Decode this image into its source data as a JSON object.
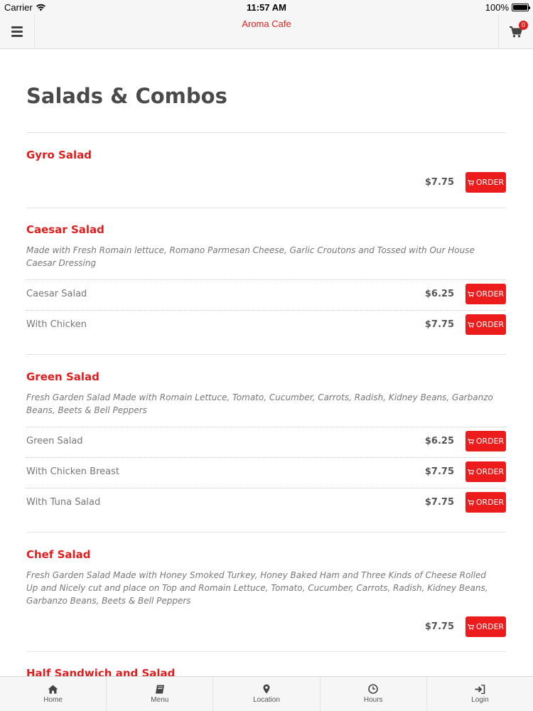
{
  "status_bar": {
    "carrier": "Carrier",
    "time": "11:57 AM",
    "battery": "100%"
  },
  "header": {
    "title": "Aroma Cafe",
    "cart_count": "0"
  },
  "page_title": "Salads & Combos",
  "order_label": "ORDER",
  "items": [
    {
      "title": "Gyro Salad",
      "description": "",
      "options": [
        {
          "name": "",
          "price": "$7.75"
        }
      ]
    },
    {
      "title": "Caesar Salad",
      "description": "Made with Fresh Romain lettuce, Romano Parmesan Cheese, Garlic Croutons and Tossed with Our House Caesar Dressing",
      "options": [
        {
          "name": "Caesar Salad",
          "price": "$6.25"
        },
        {
          "name": "With Chicken",
          "price": "$7.75"
        }
      ]
    },
    {
      "title": "Green Salad",
      "description": "Fresh Garden Salad Made with Romain Lettuce, Tomato, Cucumber, Carrots, Radish, Kidney Beans, Garbanzo Beans, Beets & Bell Peppers",
      "options": [
        {
          "name": "Green Salad",
          "price": "$6.25"
        },
        {
          "name": "With Chicken Breast",
          "price": "$7.75"
        },
        {
          "name": "With Tuna Salad",
          "price": "$7.75"
        }
      ]
    },
    {
      "title": "Chef Salad",
      "description": "Fresh Garden Salad Made with Honey Smoked Turkey, Honey Baked Ham and Three Kinds of Cheese Rolled Up and Nicely cut and place on Top and Romain Lettuce, Tomato, Cucumber, Carrots, Radish, Kidney Beans, Garbanzo Beans, Beets & Bell Peppers",
      "options": [
        {
          "name": "",
          "price": "$7.75"
        }
      ]
    },
    {
      "title": "Half Sandwich and Salad",
      "description": "",
      "options": []
    }
  ],
  "tabs": [
    {
      "label": "Home",
      "icon": "home-icon"
    },
    {
      "label": "Menu",
      "icon": "book-icon"
    },
    {
      "label": "Location",
      "icon": "map-marker-icon"
    },
    {
      "label": "Hours",
      "icon": "clock-icon"
    },
    {
      "label": "Login",
      "icon": "sign-in-icon"
    }
  ]
}
